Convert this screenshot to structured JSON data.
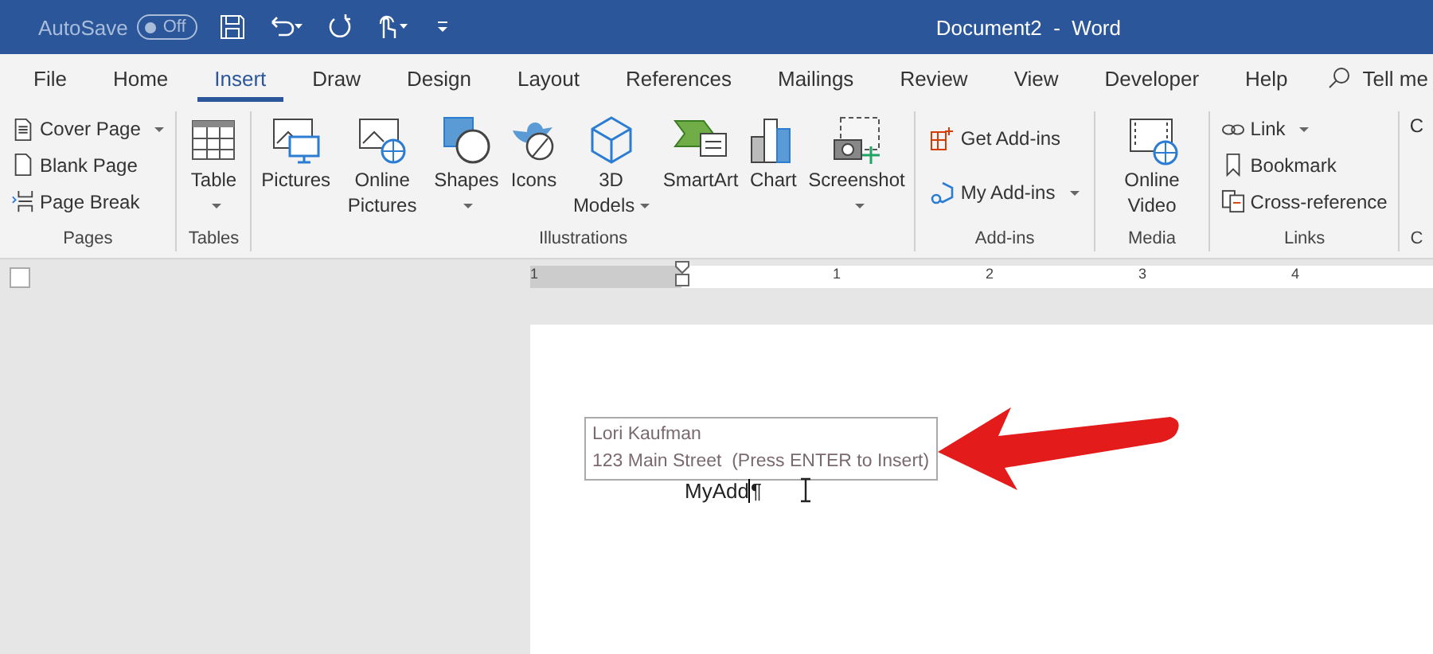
{
  "title_bar": {
    "autosave": {
      "label": "AutoSave",
      "toggle": "Off",
      "on": false
    },
    "title": "Document2  -  Word"
  },
  "tabs": [
    {
      "label": "File",
      "selected": false
    },
    {
      "label": "Home",
      "selected": false
    },
    {
      "label": "Insert",
      "selected": true
    },
    {
      "label": "Draw",
      "selected": false
    },
    {
      "label": "Design",
      "selected": false
    },
    {
      "label": "Layout",
      "selected": false
    },
    {
      "label": "References",
      "selected": false
    },
    {
      "label": "Mailings",
      "selected": false
    },
    {
      "label": "Review",
      "selected": false
    },
    {
      "label": "View",
      "selected": false
    },
    {
      "label": "Developer",
      "selected": false
    },
    {
      "label": "Help",
      "selected": false
    }
  ],
  "tell_me": "Tell me",
  "ribbon_groups": [
    {
      "label": "Pages",
      "items": [
        {
          "kind": "small",
          "label": "Cover Page",
          "dropdown": true
        },
        {
          "kind": "small",
          "label": "Blank Page",
          "dropdown": false
        },
        {
          "kind": "small",
          "label": "Page Break",
          "dropdown": false
        }
      ]
    },
    {
      "label": "Tables",
      "items": [
        {
          "kind": "large",
          "label": "Table",
          "dropdown": true
        }
      ]
    },
    {
      "label": "Illustrations",
      "items": [
        {
          "kind": "large",
          "label": "Pictures",
          "dropdown": false
        },
        {
          "kind": "large",
          "label": "Online Pictures",
          "dropdown": false
        },
        {
          "kind": "large",
          "label": "Shapes",
          "dropdown": true
        },
        {
          "kind": "large",
          "label": "Icons",
          "dropdown": false
        },
        {
          "kind": "large",
          "label": "3D Models",
          "dropdown": true
        },
        {
          "kind": "large",
          "label": "SmartArt",
          "dropdown": false
        },
        {
          "kind": "large",
          "label": "Chart",
          "dropdown": false
        },
        {
          "kind": "large",
          "label": "Screenshot",
          "dropdown": true
        }
      ]
    },
    {
      "label": "Add-ins",
      "items": [
        {
          "kind": "medium",
          "label": "Get Add-ins",
          "dropdown": false
        },
        {
          "kind": "medium",
          "label": "My Add-ins",
          "dropdown": true
        }
      ]
    },
    {
      "label": "Media",
      "items": [
        {
          "kind": "large",
          "label": "Online Video",
          "dropdown": false
        }
      ]
    },
    {
      "label": "Links",
      "items": [
        {
          "kind": "small",
          "label": "Link",
          "dropdown": true
        },
        {
          "kind": "small",
          "label": "Bookmark",
          "dropdown": false
        },
        {
          "kind": "small",
          "label": "Cross-reference",
          "dropdown": false
        }
      ]
    },
    {
      "label": "C",
      "items": [
        {
          "kind": "large",
          "label": "C",
          "dropdown": false
        }
      ]
    }
  ],
  "ruler": {
    "numbers": [
      "1",
      "1",
      "2",
      "3",
      "4"
    ]
  },
  "document": {
    "autocomplete": [
      "Lori Kaufman",
      "123 Main Street  (Press ENTER to Insert)"
    ],
    "typed_text": "MyAdd",
    "paragraph_mark": "¶"
  }
}
